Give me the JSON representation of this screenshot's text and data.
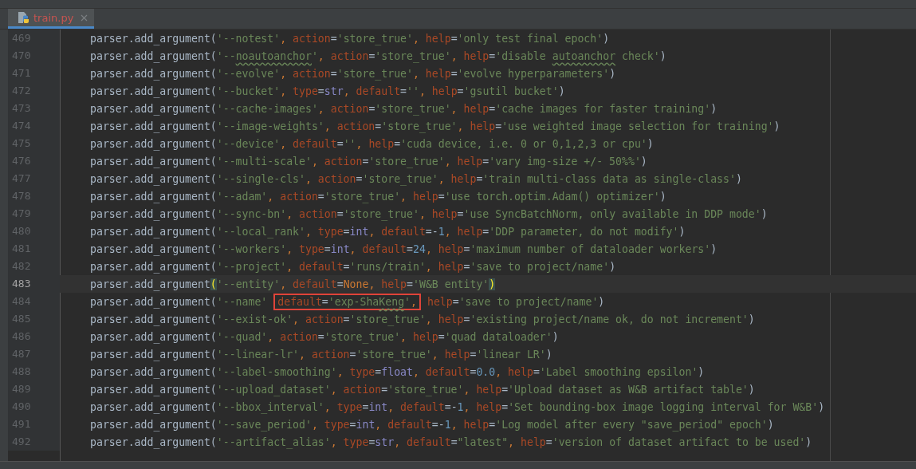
{
  "tabs": [
    {
      "label": "train.py",
      "selected": true,
      "has_errors": true
    }
  ],
  "lines": [
    {
      "number": "469",
      "current": false,
      "tokens": [
        {
          "kind": "plain",
          "text": "parser.add_argument("
        },
        {
          "kind": "string",
          "text": "'--notest'"
        },
        {
          "kind": "comma",
          "text": ", "
        },
        {
          "kind": "param",
          "text": "action"
        },
        {
          "kind": "plain",
          "text": "="
        },
        {
          "kind": "string",
          "text": "'store_true'"
        },
        {
          "kind": "comma",
          "text": ", "
        },
        {
          "kind": "param",
          "text": "help"
        },
        {
          "kind": "plain",
          "text": "="
        },
        {
          "kind": "string",
          "text": "'only test final epoch'"
        },
        {
          "kind": "plain",
          "text": ")"
        }
      ]
    },
    {
      "number": "470",
      "current": false,
      "tokens": [
        {
          "kind": "plain",
          "text": "parser.add_argument("
        },
        {
          "kind": "string",
          "text": "'--"
        },
        {
          "kind": "string",
          "text": "noautoanchor",
          "typo": true
        },
        {
          "kind": "string",
          "text": "'"
        },
        {
          "kind": "comma",
          "text": ", "
        },
        {
          "kind": "param",
          "text": "action"
        },
        {
          "kind": "plain",
          "text": "="
        },
        {
          "kind": "string",
          "text": "'store_true'"
        },
        {
          "kind": "comma",
          "text": ", "
        },
        {
          "kind": "param",
          "text": "help"
        },
        {
          "kind": "plain",
          "text": "="
        },
        {
          "kind": "string",
          "text": "'disable "
        },
        {
          "kind": "string",
          "text": "autoanchor",
          "typo": true
        },
        {
          "kind": "string",
          "text": " check'"
        },
        {
          "kind": "plain",
          "text": ")"
        }
      ]
    },
    {
      "number": "471",
      "current": false,
      "tokens": [
        {
          "kind": "plain",
          "text": "parser.add_argument("
        },
        {
          "kind": "string",
          "text": "'--evolve'"
        },
        {
          "kind": "comma",
          "text": ", "
        },
        {
          "kind": "param",
          "text": "action"
        },
        {
          "kind": "plain",
          "text": "="
        },
        {
          "kind": "string",
          "text": "'store_true'"
        },
        {
          "kind": "comma",
          "text": ", "
        },
        {
          "kind": "param",
          "text": "help"
        },
        {
          "kind": "plain",
          "text": "="
        },
        {
          "kind": "string",
          "text": "'evolve hyperparameters'"
        },
        {
          "kind": "plain",
          "text": ")"
        }
      ]
    },
    {
      "number": "472",
      "current": false,
      "tokens": [
        {
          "kind": "plain",
          "text": "parser.add_argument("
        },
        {
          "kind": "string",
          "text": "'--bucket'"
        },
        {
          "kind": "comma",
          "text": ", "
        },
        {
          "kind": "param",
          "text": "type"
        },
        {
          "kind": "plain",
          "text": "="
        },
        {
          "kind": "builtin",
          "text": "str"
        },
        {
          "kind": "comma",
          "text": ", "
        },
        {
          "kind": "param",
          "text": "default"
        },
        {
          "kind": "plain",
          "text": "="
        },
        {
          "kind": "string",
          "text": "''"
        },
        {
          "kind": "comma",
          "text": ", "
        },
        {
          "kind": "param",
          "text": "help"
        },
        {
          "kind": "plain",
          "text": "="
        },
        {
          "kind": "string",
          "text": "'gsutil bucket'"
        },
        {
          "kind": "plain",
          "text": ")"
        }
      ]
    },
    {
      "number": "473",
      "current": false,
      "tokens": [
        {
          "kind": "plain",
          "text": "parser.add_argument("
        },
        {
          "kind": "string",
          "text": "'--cache-images'"
        },
        {
          "kind": "comma",
          "text": ", "
        },
        {
          "kind": "param",
          "text": "action"
        },
        {
          "kind": "plain",
          "text": "="
        },
        {
          "kind": "string",
          "text": "'store_true'"
        },
        {
          "kind": "comma",
          "text": ", "
        },
        {
          "kind": "param",
          "text": "help"
        },
        {
          "kind": "plain",
          "text": "="
        },
        {
          "kind": "string",
          "text": "'cache images for faster training'"
        },
        {
          "kind": "plain",
          "text": ")"
        }
      ]
    },
    {
      "number": "474",
      "current": false,
      "tokens": [
        {
          "kind": "plain",
          "text": "parser.add_argument("
        },
        {
          "kind": "string",
          "text": "'--image-weights'"
        },
        {
          "kind": "comma",
          "text": ", "
        },
        {
          "kind": "param",
          "text": "action"
        },
        {
          "kind": "plain",
          "text": "="
        },
        {
          "kind": "string",
          "text": "'store_true'"
        },
        {
          "kind": "comma",
          "text": ", "
        },
        {
          "kind": "param",
          "text": "help"
        },
        {
          "kind": "plain",
          "text": "="
        },
        {
          "kind": "string",
          "text": "'use weighted image selection for training'"
        },
        {
          "kind": "plain",
          "text": ")"
        }
      ]
    },
    {
      "number": "475",
      "current": false,
      "tokens": [
        {
          "kind": "plain",
          "text": "parser.add_argument("
        },
        {
          "kind": "string",
          "text": "'--device'"
        },
        {
          "kind": "comma",
          "text": ", "
        },
        {
          "kind": "param",
          "text": "default"
        },
        {
          "kind": "plain",
          "text": "="
        },
        {
          "kind": "string",
          "text": "''"
        },
        {
          "kind": "comma",
          "text": ", "
        },
        {
          "kind": "param",
          "text": "help"
        },
        {
          "kind": "plain",
          "text": "="
        },
        {
          "kind": "string",
          "text": "'cuda device, i.e. 0 or 0,1,2,3 or cpu'"
        },
        {
          "kind": "plain",
          "text": ")"
        }
      ]
    },
    {
      "number": "476",
      "current": false,
      "tokens": [
        {
          "kind": "plain",
          "text": "parser.add_argument("
        },
        {
          "kind": "string",
          "text": "'--multi-scale'"
        },
        {
          "kind": "comma",
          "text": ", "
        },
        {
          "kind": "param",
          "text": "action"
        },
        {
          "kind": "plain",
          "text": "="
        },
        {
          "kind": "string",
          "text": "'store_true'"
        },
        {
          "kind": "comma",
          "text": ", "
        },
        {
          "kind": "param",
          "text": "help"
        },
        {
          "kind": "plain",
          "text": "="
        },
        {
          "kind": "string",
          "text": "'vary img-size +/- 50%%'"
        },
        {
          "kind": "plain",
          "text": ")"
        }
      ]
    },
    {
      "number": "477",
      "current": false,
      "tokens": [
        {
          "kind": "plain",
          "text": "parser.add_argument("
        },
        {
          "kind": "string",
          "text": "'--single-cls'"
        },
        {
          "kind": "comma",
          "text": ", "
        },
        {
          "kind": "param",
          "text": "action"
        },
        {
          "kind": "plain",
          "text": "="
        },
        {
          "kind": "string",
          "text": "'store_true'"
        },
        {
          "kind": "comma",
          "text": ", "
        },
        {
          "kind": "param",
          "text": "help"
        },
        {
          "kind": "plain",
          "text": "="
        },
        {
          "kind": "string",
          "text": "'train multi-class data as single-class'"
        },
        {
          "kind": "plain",
          "text": ")"
        }
      ]
    },
    {
      "number": "478",
      "current": false,
      "tokens": [
        {
          "kind": "plain",
          "text": "parser.add_argument("
        },
        {
          "kind": "string",
          "text": "'--adam'"
        },
        {
          "kind": "comma",
          "text": ", "
        },
        {
          "kind": "param",
          "text": "action"
        },
        {
          "kind": "plain",
          "text": "="
        },
        {
          "kind": "string",
          "text": "'store_true'"
        },
        {
          "kind": "comma",
          "text": ", "
        },
        {
          "kind": "param",
          "text": "help"
        },
        {
          "kind": "plain",
          "text": "="
        },
        {
          "kind": "string",
          "text": "'use torch.optim.Adam() optimizer'"
        },
        {
          "kind": "plain",
          "text": ")"
        }
      ]
    },
    {
      "number": "479",
      "current": false,
      "tokens": [
        {
          "kind": "plain",
          "text": "parser.add_argument("
        },
        {
          "kind": "string",
          "text": "'--sync-bn'"
        },
        {
          "kind": "comma",
          "text": ", "
        },
        {
          "kind": "param",
          "text": "action"
        },
        {
          "kind": "plain",
          "text": "="
        },
        {
          "kind": "string",
          "text": "'store_true'"
        },
        {
          "kind": "comma",
          "text": ", "
        },
        {
          "kind": "param",
          "text": "help"
        },
        {
          "kind": "plain",
          "text": "="
        },
        {
          "kind": "string",
          "text": "'use SyncBatchNorm, only available in DDP mode'"
        },
        {
          "kind": "plain",
          "text": ")"
        }
      ]
    },
    {
      "number": "480",
      "current": false,
      "tokens": [
        {
          "kind": "plain",
          "text": "parser.add_argument("
        },
        {
          "kind": "string",
          "text": "'--local_rank'"
        },
        {
          "kind": "comma",
          "text": ", "
        },
        {
          "kind": "param",
          "text": "type"
        },
        {
          "kind": "plain",
          "text": "="
        },
        {
          "kind": "builtin",
          "text": "int"
        },
        {
          "kind": "comma",
          "text": ", "
        },
        {
          "kind": "param",
          "text": "default"
        },
        {
          "kind": "plain",
          "text": "=-"
        },
        {
          "kind": "number",
          "text": "1"
        },
        {
          "kind": "comma",
          "text": ", "
        },
        {
          "kind": "param",
          "text": "help"
        },
        {
          "kind": "plain",
          "text": "="
        },
        {
          "kind": "string",
          "text": "'DDP parameter, do not modify'"
        },
        {
          "kind": "plain",
          "text": ")"
        }
      ]
    },
    {
      "number": "481",
      "current": false,
      "tokens": [
        {
          "kind": "plain",
          "text": "parser.add_argument("
        },
        {
          "kind": "string",
          "text": "'--workers'"
        },
        {
          "kind": "comma",
          "text": ", "
        },
        {
          "kind": "param",
          "text": "type"
        },
        {
          "kind": "plain",
          "text": "="
        },
        {
          "kind": "builtin",
          "text": "int"
        },
        {
          "kind": "comma",
          "text": ", "
        },
        {
          "kind": "param",
          "text": "default"
        },
        {
          "kind": "plain",
          "text": "="
        },
        {
          "kind": "number",
          "text": "24"
        },
        {
          "kind": "comma",
          "text": ", "
        },
        {
          "kind": "param",
          "text": "help"
        },
        {
          "kind": "plain",
          "text": "="
        },
        {
          "kind": "string",
          "text": "'maximum number of dataloader workers'"
        },
        {
          "kind": "plain",
          "text": ")"
        }
      ]
    },
    {
      "number": "482",
      "current": false,
      "tokens": [
        {
          "kind": "plain",
          "text": "parser.add_argument("
        },
        {
          "kind": "string",
          "text": "'--project'"
        },
        {
          "kind": "comma",
          "text": ", "
        },
        {
          "kind": "param",
          "text": "default"
        },
        {
          "kind": "plain",
          "text": "="
        },
        {
          "kind": "string",
          "text": "'runs/train'"
        },
        {
          "kind": "comma",
          "text": ", "
        },
        {
          "kind": "param",
          "text": "help"
        },
        {
          "kind": "plain",
          "text": "="
        },
        {
          "kind": "string",
          "text": "'save to project/name'"
        },
        {
          "kind": "plain",
          "text": ")"
        }
      ]
    },
    {
      "number": "483",
      "current": true,
      "tokens": [
        {
          "kind": "plain",
          "text": "parser.add_argument"
        },
        {
          "kind": "brace-match",
          "text": "("
        },
        {
          "kind": "string",
          "text": "'--entity'"
        },
        {
          "kind": "comma",
          "text": ", "
        },
        {
          "kind": "param",
          "text": "default"
        },
        {
          "kind": "plain",
          "text": "="
        },
        {
          "kind": "keyword",
          "text": "None"
        },
        {
          "kind": "comma",
          "text": ", "
        },
        {
          "kind": "param",
          "text": "help"
        },
        {
          "kind": "plain",
          "text": "="
        },
        {
          "kind": "string",
          "text": "'W&B entity'"
        },
        {
          "kind": "brace-match",
          "text": ")"
        }
      ]
    },
    {
      "number": "484",
      "current": false,
      "tokens": [
        {
          "kind": "plain",
          "text": "parser.add_argument("
        },
        {
          "kind": "string",
          "text": "'--name' "
        },
        {
          "kind": "highlight",
          "tokens": [
            {
              "kind": "param",
              "text": "default"
            },
            {
              "kind": "plain",
              "text": "="
            },
            {
              "kind": "string",
              "text": "'exp-Sha"
            },
            {
              "kind": "string",
              "text": "Keng",
              "typo": true
            },
            {
              "kind": "string",
              "text": "'"
            },
            {
              "kind": "comma",
              "text": ","
            }
          ]
        },
        {
          "kind": "param",
          "text": " help"
        },
        {
          "kind": "plain",
          "text": "="
        },
        {
          "kind": "string",
          "text": "'save to project/name'"
        },
        {
          "kind": "plain",
          "text": ")"
        }
      ]
    },
    {
      "number": "485",
      "current": false,
      "tokens": [
        {
          "kind": "plain",
          "text": "parser.add_argument("
        },
        {
          "kind": "string",
          "text": "'--exist-ok'"
        },
        {
          "kind": "comma",
          "text": ", "
        },
        {
          "kind": "param",
          "text": "action"
        },
        {
          "kind": "plain",
          "text": "="
        },
        {
          "kind": "string",
          "text": "'store_true'"
        },
        {
          "kind": "comma",
          "text": ", "
        },
        {
          "kind": "param",
          "text": "help"
        },
        {
          "kind": "plain",
          "text": "="
        },
        {
          "kind": "string",
          "text": "'existing project/name ok, do not increment'"
        },
        {
          "kind": "plain",
          "text": ")"
        }
      ]
    },
    {
      "number": "486",
      "current": false,
      "tokens": [
        {
          "kind": "plain",
          "text": "parser.add_argument("
        },
        {
          "kind": "string",
          "text": "'--quad'"
        },
        {
          "kind": "comma",
          "text": ", "
        },
        {
          "kind": "param",
          "text": "action"
        },
        {
          "kind": "plain",
          "text": "="
        },
        {
          "kind": "string",
          "text": "'store_true'"
        },
        {
          "kind": "comma",
          "text": ", "
        },
        {
          "kind": "param",
          "text": "help"
        },
        {
          "kind": "plain",
          "text": "="
        },
        {
          "kind": "string",
          "text": "'quad dataloader'"
        },
        {
          "kind": "plain",
          "text": ")"
        }
      ]
    },
    {
      "number": "487",
      "current": false,
      "tokens": [
        {
          "kind": "plain",
          "text": "parser.add_argument("
        },
        {
          "kind": "string",
          "text": "'--linear-lr'"
        },
        {
          "kind": "comma",
          "text": ", "
        },
        {
          "kind": "param",
          "text": "action"
        },
        {
          "kind": "plain",
          "text": "="
        },
        {
          "kind": "string",
          "text": "'store_true'"
        },
        {
          "kind": "comma",
          "text": ", "
        },
        {
          "kind": "param",
          "text": "help"
        },
        {
          "kind": "plain",
          "text": "="
        },
        {
          "kind": "string",
          "text": "'linear LR'"
        },
        {
          "kind": "plain",
          "text": ")"
        }
      ]
    },
    {
      "number": "488",
      "current": false,
      "tokens": [
        {
          "kind": "plain",
          "text": "parser.add_argument("
        },
        {
          "kind": "string",
          "text": "'--label-smoothing'"
        },
        {
          "kind": "comma",
          "text": ", "
        },
        {
          "kind": "param",
          "text": "type"
        },
        {
          "kind": "plain",
          "text": "="
        },
        {
          "kind": "builtin",
          "text": "float"
        },
        {
          "kind": "comma",
          "text": ", "
        },
        {
          "kind": "param",
          "text": "default"
        },
        {
          "kind": "plain",
          "text": "="
        },
        {
          "kind": "number",
          "text": "0.0"
        },
        {
          "kind": "comma",
          "text": ", "
        },
        {
          "kind": "param",
          "text": "help"
        },
        {
          "kind": "plain",
          "text": "="
        },
        {
          "kind": "string",
          "text": "'Label smoothing epsilon'"
        },
        {
          "kind": "plain",
          "text": ")"
        }
      ]
    },
    {
      "number": "489",
      "current": false,
      "tokens": [
        {
          "kind": "plain",
          "text": "parser.add_argument("
        },
        {
          "kind": "string",
          "text": "'--upload_dataset'"
        },
        {
          "kind": "comma",
          "text": ", "
        },
        {
          "kind": "param",
          "text": "action"
        },
        {
          "kind": "plain",
          "text": "="
        },
        {
          "kind": "string",
          "text": "'store_true'"
        },
        {
          "kind": "comma",
          "text": ", "
        },
        {
          "kind": "param",
          "text": "help"
        },
        {
          "kind": "plain",
          "text": "="
        },
        {
          "kind": "string",
          "text": "'Upload dataset as W&B artifact table'"
        },
        {
          "kind": "plain",
          "text": ")"
        }
      ]
    },
    {
      "number": "490",
      "current": false,
      "tokens": [
        {
          "kind": "plain",
          "text": "parser.add_argument("
        },
        {
          "kind": "string",
          "text": "'--bbox_interval'"
        },
        {
          "kind": "comma",
          "text": ", "
        },
        {
          "kind": "param",
          "text": "type"
        },
        {
          "kind": "plain",
          "text": "="
        },
        {
          "kind": "builtin",
          "text": "int"
        },
        {
          "kind": "comma",
          "text": ", "
        },
        {
          "kind": "param",
          "text": "default"
        },
        {
          "kind": "plain",
          "text": "=-"
        },
        {
          "kind": "number",
          "text": "1"
        },
        {
          "kind": "comma",
          "text": ", "
        },
        {
          "kind": "param",
          "text": "help"
        },
        {
          "kind": "plain",
          "text": "="
        },
        {
          "kind": "string",
          "text": "'Set bounding-box image logging interval for W&B'"
        },
        {
          "kind": "plain",
          "text": ")"
        }
      ]
    },
    {
      "number": "491",
      "current": false,
      "tokens": [
        {
          "kind": "plain",
          "text": "parser.add_argument("
        },
        {
          "kind": "string",
          "text": "'--save_period'"
        },
        {
          "kind": "comma",
          "text": ", "
        },
        {
          "kind": "param",
          "text": "type"
        },
        {
          "kind": "plain",
          "text": "="
        },
        {
          "kind": "builtin",
          "text": "int"
        },
        {
          "kind": "comma",
          "text": ", "
        },
        {
          "kind": "param",
          "text": "default"
        },
        {
          "kind": "plain",
          "text": "=-"
        },
        {
          "kind": "number",
          "text": "1"
        },
        {
          "kind": "comma",
          "text": ", "
        },
        {
          "kind": "param",
          "text": "help"
        },
        {
          "kind": "plain",
          "text": "="
        },
        {
          "kind": "string",
          "text": "'Log model after every \"save_period\" epoch'"
        },
        {
          "kind": "plain",
          "text": ")"
        }
      ]
    },
    {
      "number": "492",
      "current": false,
      "tokens": [
        {
          "kind": "plain",
          "text": "parser.add_argument("
        },
        {
          "kind": "string",
          "text": "'--artifact_alias'"
        },
        {
          "kind": "comma",
          "text": ", "
        },
        {
          "kind": "param",
          "text": "type"
        },
        {
          "kind": "plain",
          "text": "="
        },
        {
          "kind": "builtin",
          "text": "str"
        },
        {
          "kind": "comma",
          "text": ", "
        },
        {
          "kind": "param",
          "text": "default"
        },
        {
          "kind": "plain",
          "text": "="
        },
        {
          "kind": "string",
          "text": "\"latest\""
        },
        {
          "kind": "comma",
          "text": ", "
        },
        {
          "kind": "param",
          "text": "help"
        },
        {
          "kind": "plain",
          "text": "="
        },
        {
          "kind": "string",
          "text": "'version of dataset artifact to be used'"
        },
        {
          "kind": "plain",
          "text": ")"
        }
      ]
    }
  ]
}
